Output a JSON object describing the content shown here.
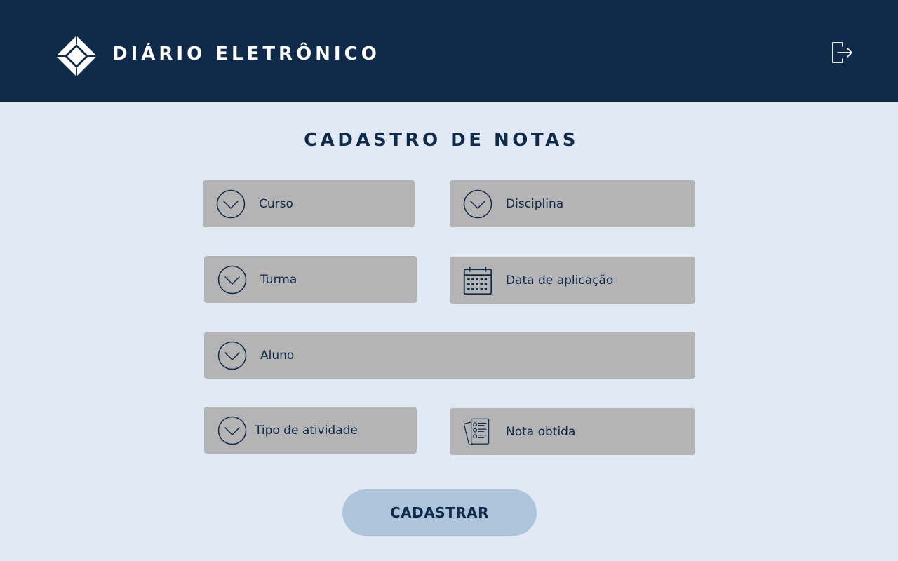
{
  "header": {
    "app_title": "DIÁRIO ELETRÔNICO",
    "logo_icon": "diamond-logo-icon",
    "logout_icon": "logout-icon"
  },
  "page_title": "CADASTRO DE NOTAS",
  "fields": {
    "curso": {
      "label": "Curso",
      "icon": "chevron-down-circle-icon"
    },
    "disciplina": {
      "label": "Disciplina",
      "icon": "chevron-down-circle-icon"
    },
    "turma": {
      "label": "Turma",
      "icon": "chevron-down-circle-icon"
    },
    "data_aplicacao": {
      "label": "Data de aplicação",
      "icon": "calendar-icon"
    },
    "aluno": {
      "label": "Aluno",
      "icon": "chevron-down-circle-icon"
    },
    "tipo_atividade": {
      "label": "Tipo de atividade",
      "icon": "chevron-down-circle-icon"
    },
    "nota_obtida": {
      "label": "Nota obtida",
      "icon": "checklist-document-icon"
    }
  },
  "submit_label": "CADASTRAR",
  "colors": {
    "header_bg": "#102a4a",
    "page_bg": "#e1eaf4",
    "field_bg": "#b4b4b4",
    "button_bg": "#aec4db",
    "text_dark": "#102a4a"
  }
}
